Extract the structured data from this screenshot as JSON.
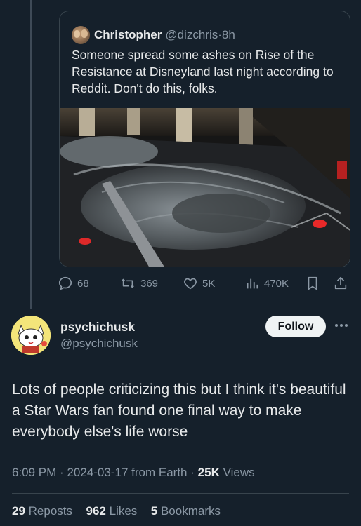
{
  "quoted_tweet": {
    "author_name": "Christopher",
    "author_handle": "@dizchris",
    "separator": "·",
    "age": "8h",
    "text": "Someone spread some ashes on Rise of the Resistance at Disneyland last night according to Reddit. Don't do this, folks."
  },
  "action_bar": {
    "replies": "68",
    "reposts": "369",
    "likes": "5K",
    "views": "470K",
    "icons": [
      "reply-icon",
      "repost-icon",
      "like-icon",
      "views-icon",
      "bookmark-icon",
      "share-icon"
    ]
  },
  "reply": {
    "author_name": "psychichusk",
    "author_handle": "@psychichusk",
    "follow_label": "Follow",
    "text": "Lots of people criticizing this but I think it's beautiful a Star Wars fan found one final way to make everybody else's life worse",
    "time": "6:09 PM",
    "date": "2024-03-17",
    "source": "from Earth",
    "dot": "·",
    "views_count": "25K",
    "views_label": "Views",
    "reposts_count": "29",
    "reposts_label": "Reposts",
    "likes_count": "962",
    "likes_label": "Likes",
    "bookmarks_count": "5",
    "bookmarks_label": "Bookmarks"
  },
  "colors": {
    "background": "#15202b",
    "text_primary": "#e7e9ea",
    "text_secondary": "#8b98a5",
    "border": "#38444d",
    "follow_button_bg": "#eff3f4"
  }
}
